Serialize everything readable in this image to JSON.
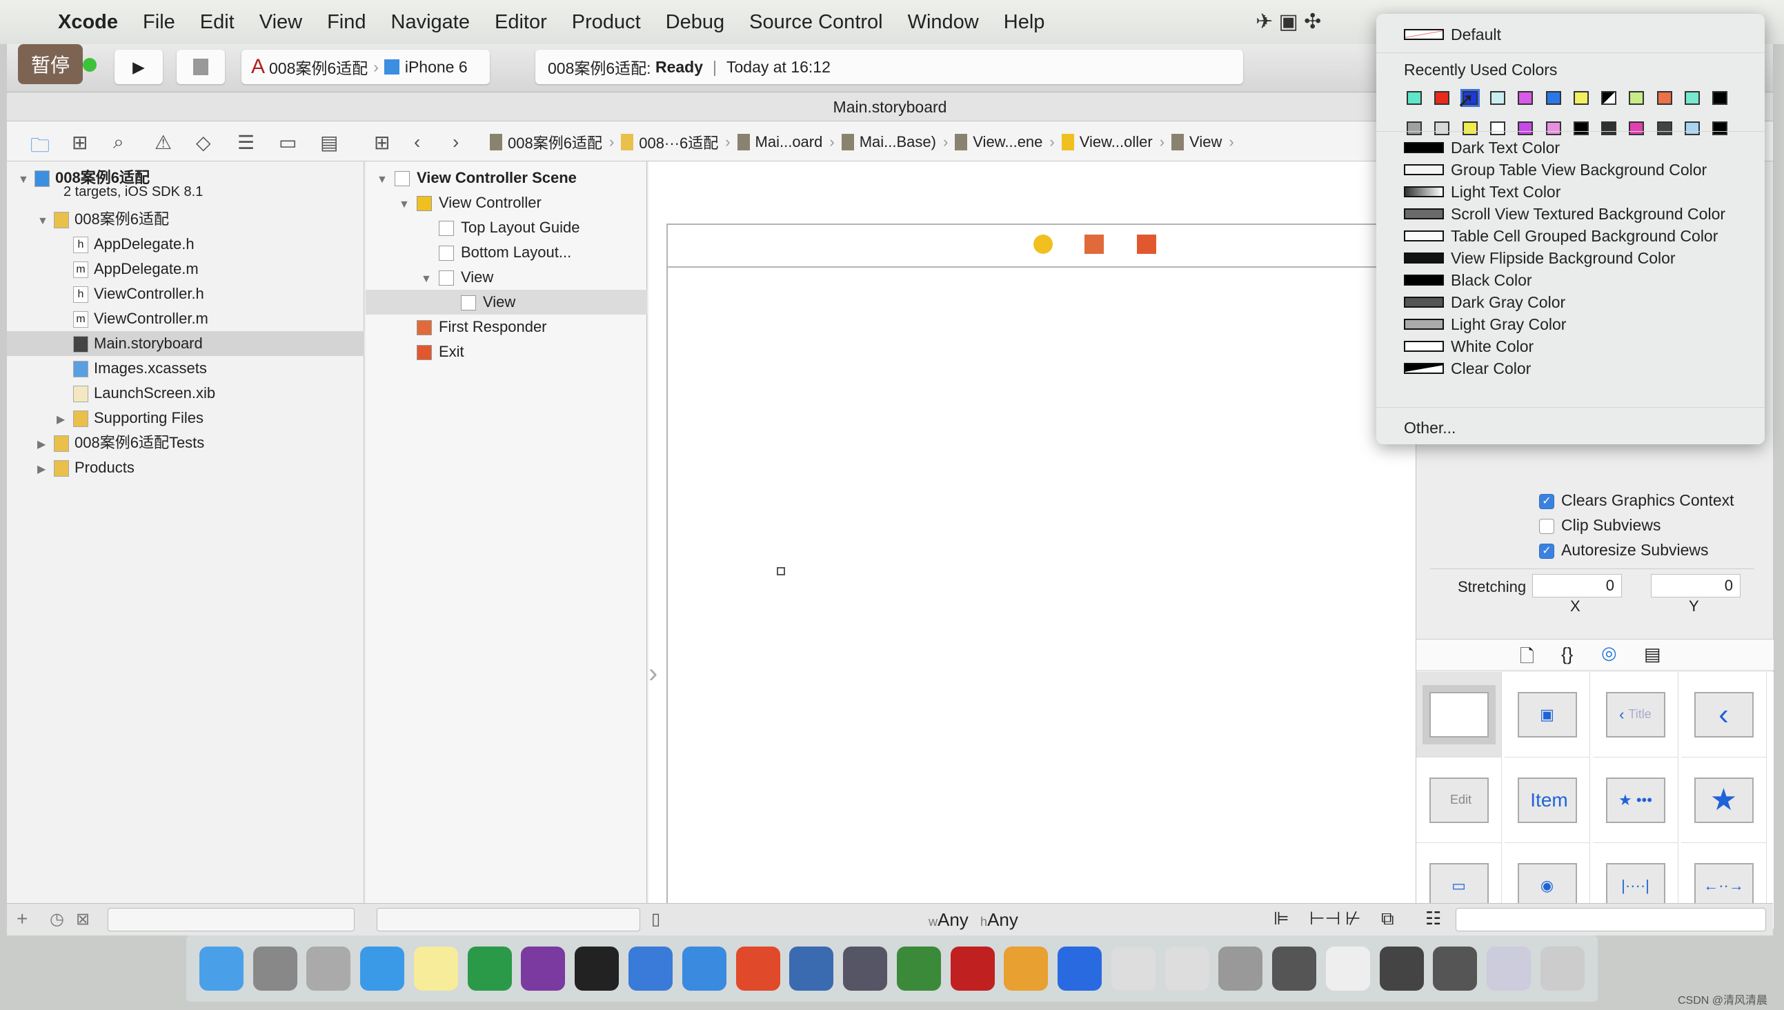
{
  "menubar": {
    "apple": "",
    "app": "Xcode",
    "items": [
      "File",
      "Edit",
      "View",
      "Find",
      "Navigate",
      "Editor",
      "Product",
      "Debug",
      "Source Control",
      "Window",
      "Help"
    ]
  },
  "toolbar": {
    "pause_label": "暂停",
    "scheme": "008案例6适配",
    "device": "iPhone 6",
    "status_project": "008案例6适配:",
    "status_state": "Ready",
    "status_time": "Today at 16:12"
  },
  "title": "Main.storyboard",
  "jumpbar": [
    "008案例6适配",
    "008···6适配",
    "Mai...oard",
    "Mai...Base)",
    "View...ene",
    "View...oller",
    "View"
  ],
  "navigator": {
    "items": [
      {
        "label": "008案例6适配",
        "sub": "2 targets, iOS SDK 8.1",
        "indent": 0,
        "icon": "project",
        "open": true
      },
      {
        "label": "008案例6适配",
        "indent": 1,
        "icon": "folder",
        "open": true
      },
      {
        "label": "AppDelegate.h",
        "indent": 2,
        "icon": "h"
      },
      {
        "label": "AppDelegate.m",
        "indent": 2,
        "icon": "m"
      },
      {
        "label": "ViewController.h",
        "indent": 2,
        "icon": "h"
      },
      {
        "label": "ViewController.m",
        "indent": 2,
        "icon": "m"
      },
      {
        "label": "Main.storyboard",
        "indent": 2,
        "icon": "storyboard",
        "selected": true
      },
      {
        "label": "Images.xcassets",
        "indent": 2,
        "icon": "assets"
      },
      {
        "label": "LaunchScreen.xib",
        "indent": 2,
        "icon": "xib"
      },
      {
        "label": "Supporting Files",
        "indent": 2,
        "icon": "folder",
        "closed": true
      },
      {
        "label": "008案例6适配Tests",
        "indent": 1,
        "icon": "folder",
        "closed": true
      },
      {
        "label": "Products",
        "indent": 1,
        "icon": "folder",
        "closed": true
      }
    ]
  },
  "outline": {
    "items": [
      {
        "label": "View Controller Scene",
        "indent": 0,
        "bold": true,
        "open": true
      },
      {
        "label": "View Controller",
        "indent": 1,
        "open": true
      },
      {
        "label": "Top Layout Guide",
        "indent": 2
      },
      {
        "label": "Bottom Layout...",
        "indent": 2
      },
      {
        "label": "View",
        "indent": 2,
        "open": true
      },
      {
        "label": "View",
        "indent": 3,
        "selected": true
      },
      {
        "label": "First Responder",
        "indent": 1
      },
      {
        "label": "Exit",
        "indent": 1
      }
    ]
  },
  "canvas": {
    "size_class_w": "w",
    "size_class_w_val": "Any",
    "size_class_h": "h",
    "size_class_h_val": "Any"
  },
  "color_menu": {
    "default": "Default",
    "recent_header": "Recently Used Colors",
    "recent_row1": [
      "#5ee6c8",
      "#e82a1c",
      "#1a3ae0",
      "#c8eef0",
      "#d85ae8",
      "#2a78e8",
      "#f2f060",
      "half",
      "#c8ec88",
      "#ec7048",
      "#78e8d0",
      "#000000"
    ],
    "recent_row2": [
      "#a0a0a0",
      "#d8d8d8",
      "#f0ec48",
      "#ffffff",
      "#c848e8",
      "#e890e0",
      "#000000",
      "#303030",
      "#e040b0",
      "#404448",
      "#a8d4f4",
      "#000000"
    ],
    "named": [
      {
        "label": "Dark Text Color",
        "swatch": "#000000"
      },
      {
        "label": "Group Table View Background Color",
        "swatch": "#f4f4f4"
      },
      {
        "label": "Light Text Color",
        "swatch": "gradient"
      },
      {
        "label": "Scroll View Textured Background Color",
        "swatch": "#6a6a6a"
      },
      {
        "label": "Table Cell Grouped Background Color",
        "swatch": "#fafafa"
      },
      {
        "label": "View Flipside Background Color",
        "swatch": "#121212"
      },
      {
        "label": "Black Color",
        "swatch": "#000000"
      },
      {
        "label": "Dark Gray Color",
        "swatch": "#555555"
      },
      {
        "label": "Light Gray Color",
        "swatch": "#aaaaaa"
      },
      {
        "label": "White Color",
        "swatch": "#ffffff"
      },
      {
        "label": "Clear Color",
        "swatch": "clear"
      }
    ],
    "other": "Other..."
  },
  "inspector": {
    "clears_graphics": "Clears Graphics Context",
    "clears_checked": true,
    "clip_subviews": "Clip Subviews",
    "clip_checked": false,
    "autoresize": "Autoresize Subviews",
    "autoresize_checked": true,
    "stretching": "Stretching",
    "stretch_x": "0",
    "stretch_y": "0",
    "x_label": "X",
    "y_label": "Y"
  },
  "library": {
    "cells": [
      "",
      "",
      "Title",
      "",
      "Edit",
      "Item",
      "",
      "",
      "",
      "",
      "",
      ""
    ]
  },
  "watermark": "CSDN @清风清晨"
}
